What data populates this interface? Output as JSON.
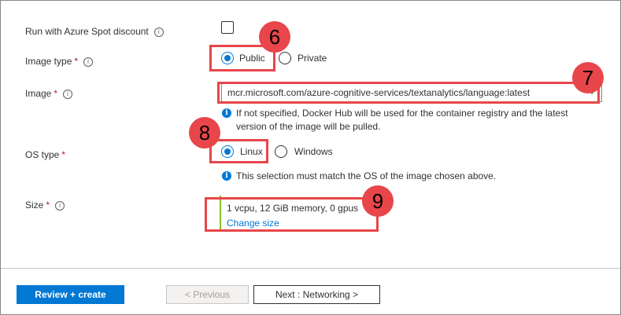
{
  "spot": {
    "label": "Run with Azure Spot discount",
    "checked": false
  },
  "image_type": {
    "label": "Image type",
    "required_mark": "*",
    "options": [
      {
        "label": "Public",
        "selected": true
      },
      {
        "label": "Private",
        "selected": false
      }
    ]
  },
  "image": {
    "label": "Image",
    "required_mark": "*",
    "value": "mcr.microsoft.com/azure-cognitive-services/textanalytics/language:latest",
    "help_line1": "If not specified, Docker Hub will be used for the container registry and the latest",
    "help_line2": "version of the image will be pulled."
  },
  "os_type": {
    "label": "OS type",
    "required_mark": "*",
    "options": [
      {
        "label": "Linux",
        "selected": true
      },
      {
        "label": "Windows",
        "selected": false
      }
    ],
    "help": "This selection must match the OS of the image chosen above."
  },
  "size": {
    "label": "Size",
    "required_mark": "*",
    "value": "1 vcpu, 12 GiB memory, 0 gpus",
    "change_link": "Change size"
  },
  "callouts": [
    "6",
    "7",
    "8",
    "9"
  ],
  "footer": {
    "review_create": "Review + create",
    "previous": "< Previous",
    "next": "Next : Networking >"
  },
  "colors": {
    "accent": "#0078d4",
    "callout": "#e8464a",
    "required": "#a4262c",
    "valid_check": "#57a300"
  }
}
